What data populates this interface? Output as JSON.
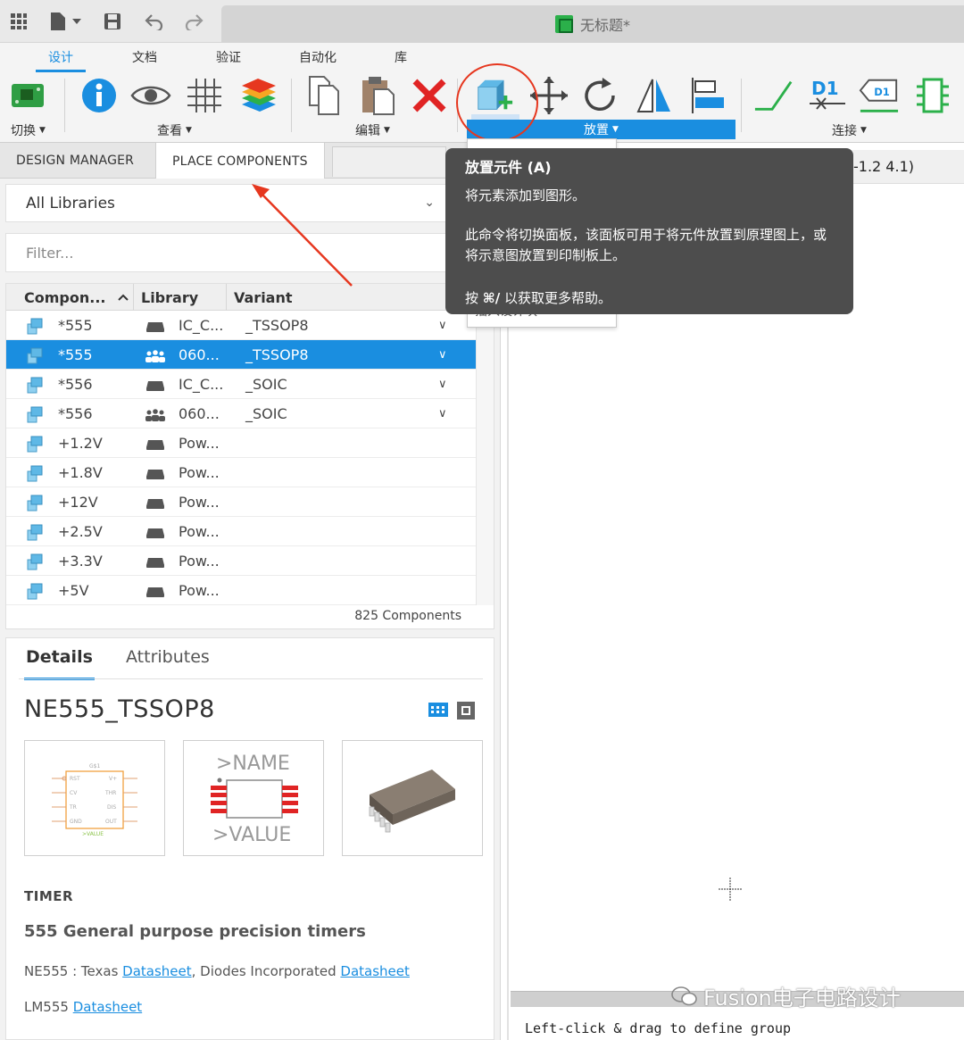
{
  "titlebar": {
    "doc_title": "无标题*"
  },
  "ribbon": {
    "tabs": [
      "设计",
      "文档",
      "验证",
      "自动化",
      "库"
    ],
    "groups": {
      "switch": "切换",
      "view": "查看",
      "edit": "编辑",
      "place": "放置",
      "connect": "连接"
    }
  },
  "panel_tabs": [
    "DESIGN MANAGER",
    "PLACE COMPONENTS"
  ],
  "library_select": {
    "value": "All Libraries"
  },
  "filter": {
    "placeholder": "Filter..."
  },
  "table": {
    "columns": [
      "Compon...",
      "Library",
      "Variant"
    ],
    "rows": [
      {
        "name": "*555",
        "library": "IC_C...",
        "variant": "_TSSOP8",
        "lib_icon": "drive-icon",
        "expandable": true,
        "selected": false
      },
      {
        "name": "*555",
        "library": "060...",
        "variant": "_TSSOP8",
        "lib_icon": "team-icon",
        "expandable": true,
        "selected": true
      },
      {
        "name": "*556",
        "library": "IC_C...",
        "variant": "_SOIC",
        "lib_icon": "drive-icon",
        "expandable": true,
        "selected": false
      },
      {
        "name": "*556",
        "library": "060...",
        "variant": "_SOIC",
        "lib_icon": "team-icon",
        "expandable": true,
        "selected": false
      },
      {
        "name": "+1.2V",
        "library": "Pow...",
        "variant": "",
        "lib_icon": "drive-icon",
        "expandable": false,
        "selected": false
      },
      {
        "name": "+1.8V",
        "library": "Pow...",
        "variant": "",
        "lib_icon": "drive-icon",
        "expandable": false,
        "selected": false
      },
      {
        "name": "+12V",
        "library": "Pow...",
        "variant": "",
        "lib_icon": "drive-icon",
        "expandable": false,
        "selected": false
      },
      {
        "name": "+2.5V",
        "library": "Pow...",
        "variant": "",
        "lib_icon": "drive-icon",
        "expandable": false,
        "selected": false
      },
      {
        "name": "+3.3V",
        "library": "Pow...",
        "variant": "",
        "lib_icon": "drive-icon",
        "expandable": false,
        "selected": false
      },
      {
        "name": "+5V",
        "library": "Pow...",
        "variant": "",
        "lib_icon": "drive-icon",
        "expandable": false,
        "selected": false
      }
    ],
    "count": "825 Components"
  },
  "details": {
    "tabs": [
      "Details",
      "Attributes"
    ],
    "part_name": "NE555_TSSOP8",
    "schematic": {
      "ref": "G$1",
      "pins_left": [
        "RST",
        "CV",
        "TR",
        "GND"
      ],
      "pins_right": [
        "V+",
        "THR",
        "DIS",
        "OUT"
      ],
      "value": ">VALUE"
    },
    "footprint": {
      "name": ">NAME",
      "value": ">VALUE"
    },
    "category": "TIMER",
    "description": "555 General purpose precision timers",
    "datasheet_line1": {
      "prefix": "NE555 : Texas ",
      "link1": "Datasheet",
      "middle": ", Diodes Incorporated ",
      "link2": "Datasheet"
    },
    "datasheet_line2": {
      "prefix": "LM555 ",
      "link": "Datasheet"
    }
  },
  "tooltip": {
    "title": "放置元件 (A)",
    "line1": "将元素添加到图形。",
    "line2": "此命令将切换面板，该面板可用于将元件放置到原理图上，或将示意图放置到印制板上。",
    "line3_prefix": "按 ",
    "line3_key": "⌘/",
    "line3_suffix": " 以获取更多帮助。"
  },
  "submenu": {
    "peek": "插入设计块"
  },
  "canvas": {
    "coord_readout": "-1.2 4.1)",
    "status_text": "Left-click & drag to define group"
  },
  "watermark": "Fusion电子电路设计",
  "colors": {
    "accent": "#1a8ee0",
    "selection": "#1a8ee0",
    "annotation_red": "#e6371f",
    "tooltip_bg": "#4d4d4d"
  }
}
